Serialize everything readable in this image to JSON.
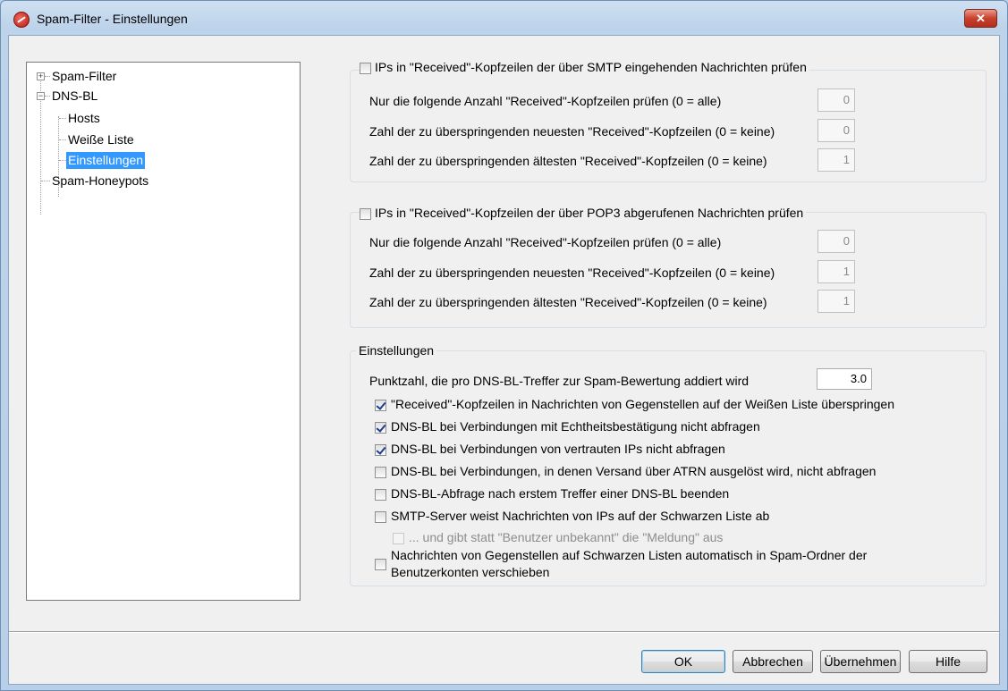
{
  "window": {
    "title": "Spam-Filter - Einstellungen",
    "close_glyph": "✕",
    "app_icon": "spam-filter-icon"
  },
  "tree": {
    "items": [
      {
        "label": "Spam-Filter",
        "expander": "+"
      },
      {
        "label": "DNS-BL",
        "expander": "−"
      },
      {
        "label": "Hosts"
      },
      {
        "label": "Weiße Liste"
      },
      {
        "label": "Einstellungen",
        "selected": true
      },
      {
        "label": "Spam-Honeypots"
      }
    ]
  },
  "smtp_group": {
    "caption": "IPs in \"Received\"-Kopfzeilen der über SMTP eingehenden Nachrichten prüfen",
    "checked": false,
    "rows": [
      {
        "label": "Nur die folgende Anzahl \"Received\"-Kopfzeilen prüfen (0 = alle)",
        "value": "0"
      },
      {
        "label": "Zahl der zu überspringenden neuesten \"Received\"-Kopfzeilen (0 = keine)",
        "value": "0"
      },
      {
        "label": "Zahl der zu überspringenden ältesten \"Received\"-Kopfzeilen (0 = keine)",
        "value": "1"
      }
    ]
  },
  "pop3_group": {
    "caption": "IPs in \"Received\"-Kopfzeilen der über POP3 abgerufenen Nachrichten prüfen",
    "checked": false,
    "rows": [
      {
        "label": "Nur die folgende Anzahl \"Received\"-Kopfzeilen prüfen (0 = alle)",
        "value": "0"
      },
      {
        "label": "Zahl der zu überspringenden neuesten \"Received\"-Kopfzeilen (0 = keine)",
        "value": "1"
      },
      {
        "label": "Zahl der zu überspringenden ältesten \"Received\"-Kopfzeilen (0 = keine)",
        "value": "1"
      }
    ]
  },
  "settings_group": {
    "caption": "Einstellungen",
    "score_label": "Punktzahl, die pro DNS-BL-Treffer zur Spam-Bewertung addiert wird",
    "score_value": "3.0",
    "options": [
      {
        "label": "\"Received\"-Kopfzeilen in Nachrichten von Gegenstellen auf der Weißen Liste überspringen",
        "checked": true
      },
      {
        "label": "DNS-BL bei Verbindungen mit Echtheitsbestätigung nicht abfragen",
        "checked": true
      },
      {
        "label": "DNS-BL bei Verbindungen von vertrauten IPs nicht abfragen",
        "checked": true
      },
      {
        "label": "DNS-BL bei Verbindungen, in denen Versand über ATRN ausgelöst wird, nicht abfragen",
        "checked": false
      },
      {
        "label": "DNS-BL-Abfrage nach erstem Treffer einer DNS-BL beenden",
        "checked": false
      },
      {
        "label": "SMTP-Server weist Nachrichten von IPs auf der Schwarzen Liste ab",
        "checked": false
      },
      {
        "label": "... und gibt statt \"Benutzer unbekannt\" die \"Meldung\" aus",
        "checked": false,
        "disabled": true
      },
      {
        "label_line1": "Nachrichten von Gegenstellen auf Schwarzen Listen automatisch in Spam-Ordner der",
        "label_line2": "Benutzerkonten verschieben",
        "checked": false
      }
    ]
  },
  "buttons": {
    "ok": "OK",
    "cancel": "Abbrechen",
    "apply": "Übernehmen",
    "help": "Hilfe"
  }
}
